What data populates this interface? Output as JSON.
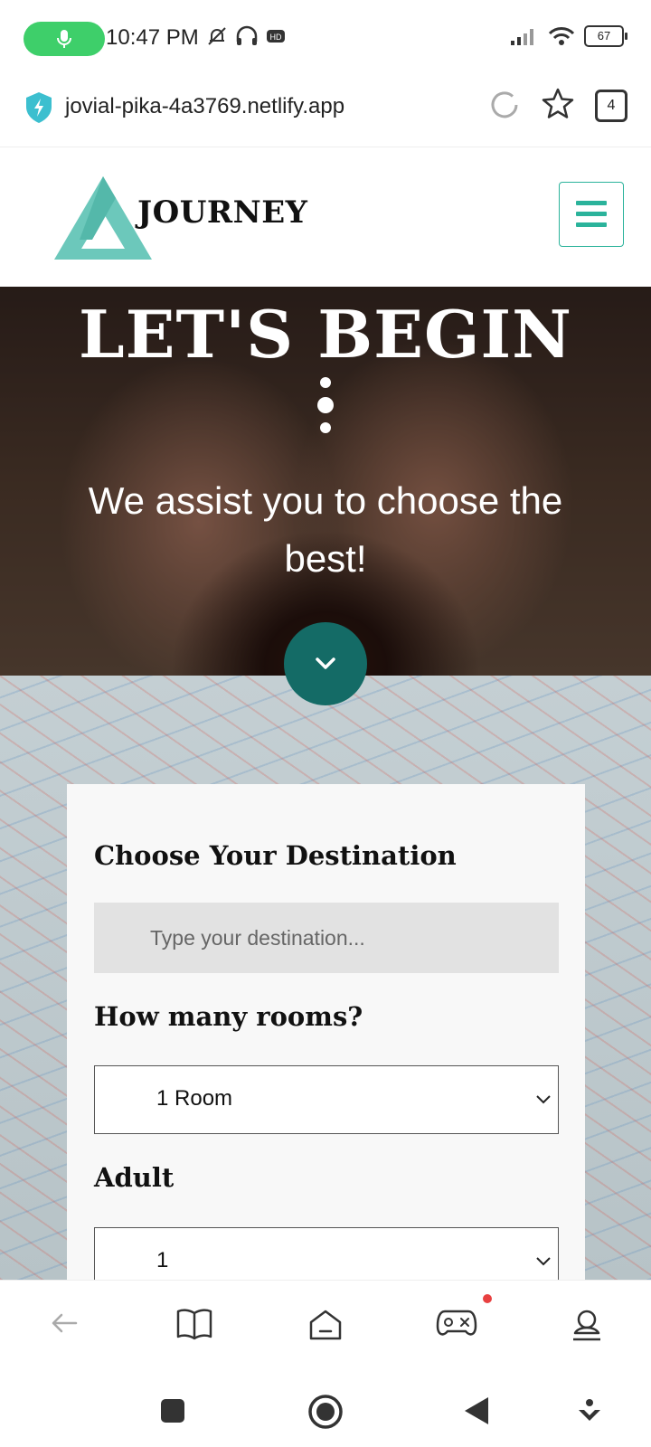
{
  "status_bar": {
    "time": "10:47 PM",
    "battery": "67"
  },
  "browser": {
    "url": "jovial-pika-4a3769.netlify.app",
    "tab_count": "4"
  },
  "site": {
    "brand": "JOURNEY"
  },
  "hero": {
    "title": "LET'S BEGIN",
    "subtitle": "We assist you to choose the best!"
  },
  "form": {
    "destination_label": "Choose Your Destination",
    "destination_placeholder": "Type your destination...",
    "rooms_label": "How many rooms?",
    "rooms_value": "1 Room",
    "adult_label": "Adult",
    "adult_value": "1"
  },
  "colors": {
    "accent": "#2bb39b",
    "scroll_button": "#146b66",
    "notification": "#e84040"
  }
}
